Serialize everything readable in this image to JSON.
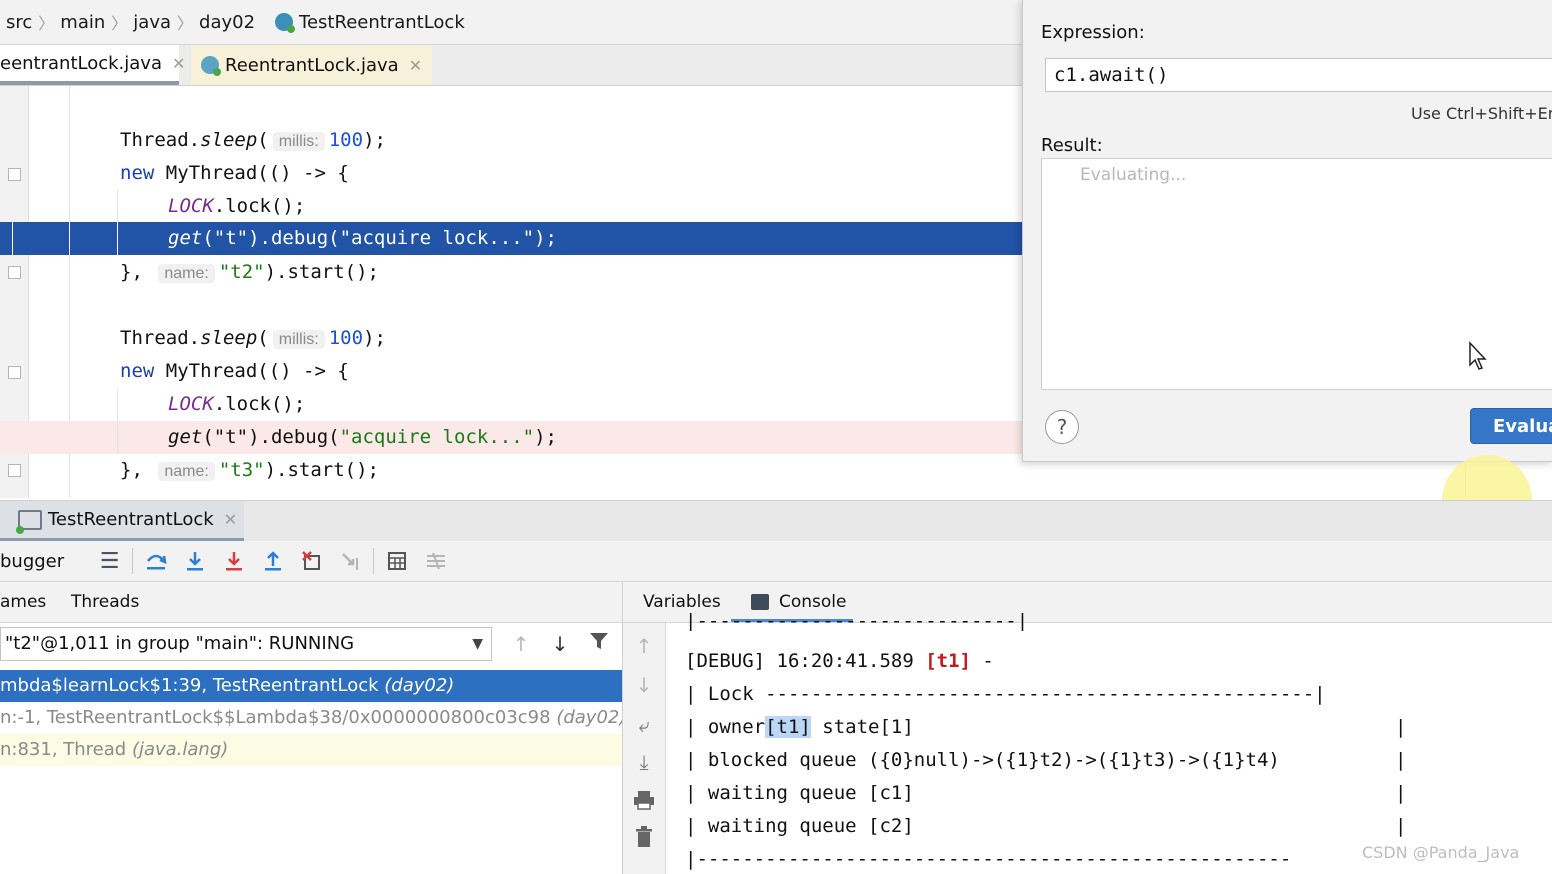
{
  "breadcrumb": {
    "items": [
      "src",
      "main",
      "java",
      "day02"
    ],
    "class_name": "TestReentrantLock"
  },
  "editor_tabs": [
    {
      "label": "eentrantLock.java"
    },
    {
      "label": "ReentrantLock.java"
    }
  ],
  "code": {
    "sleep": "Thread.",
    "sleep_method": "sleep",
    "open_paren": "(",
    "millis_hint": "millis:",
    "millis_value": "100",
    "close_semi": ");",
    "new_kw": "new",
    "mythread": " MyThread(() -> {",
    "lock_const": "LOCK",
    "lock_call": ".lock();",
    "get_method": "get",
    "debug_call_a": "(\"t\").debug(",
    "debug_string": "\"acquire lock...\"",
    "close_brace": "},",
    "name_hint": "name:",
    "t2_string": "\"t2\"",
    "t3_string": "\"t3\"",
    "start_call": ").start();"
  },
  "evaluate": {
    "expression_label": "Expression:",
    "expression_value": "c1.await()",
    "shortcut_hint": "Use Ctrl+Shift+Ent",
    "result_label": "Result:",
    "result_placeholder": "Evaluating...",
    "help_label": "?",
    "evaluate_button": "Evaluate"
  },
  "run_tab": {
    "label": "TestReentrantLock"
  },
  "debugger": {
    "label": "bugger",
    "toolbar_icons": [
      "menu-icon",
      "step-over-icon",
      "step-into-icon",
      "force-step-into-icon",
      "step-out-icon",
      "drop-frame-icon",
      "run-to-cursor-icon",
      "evaluate-icon",
      "trace-icon"
    ]
  },
  "frames": {
    "tabs": [
      "ames",
      "Threads"
    ],
    "thread_select": "\"t2\"@1,011 in group \"main\": RUNNING",
    "rows": [
      {
        "method": "mbda$learnLock$1:39, TestReentrantLock ",
        "pkg": "(day02)"
      },
      {
        "method": "n:-1, TestReentrantLock$$Lambda$38/0x0000000800c03c98 ",
        "pkg": "(day02)"
      },
      {
        "method": "n:831, Thread ",
        "pkg": "(java.lang)"
      }
    ]
  },
  "console": {
    "tabs": [
      "Variables",
      "Console"
    ],
    "lines": {
      "top_border": "|----------------------------|",
      "debug_prefix": "[DEBUG] 16:20:41.589 ",
      "debug_thread": "[t1]",
      "debug_suffix": " -",
      "lock_line": "| Lock ------------------------------------------------|",
      "owner_prefix": "| owner",
      "owner_value": "[t1]",
      "owner_suffix": " state[1]",
      "blocked": "| blocked queue ({0}null)->({1}t2)->({1}t3)->({1}t4)",
      "waiting1": "| waiting queue [c1]",
      "waiting2": "| waiting queue [c2]",
      "bottom_border": "|----------------------------------------------------",
      "pipe": "|"
    }
  },
  "watermark": "CSDN @Panda_Java",
  "colors": {
    "selection_blue": "#2153a6",
    "frame_selected": "#2d6fc0",
    "button_blue": "#3576c9"
  }
}
